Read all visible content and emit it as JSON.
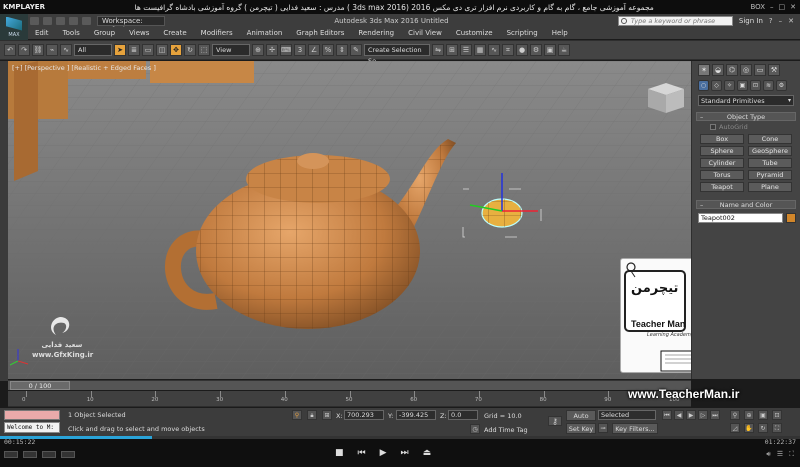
{
  "player": {
    "logo": "KMPLAYER",
    "title": "مجموعه آموزشی جامع ، گام به گام و کاربردی نرم افزار تری دی مکس 2016 (3ds max 2016 ) مدرس : سعید فدایی ( تیچرمن ) گروه آموزشی بادشاه گرافیست ها",
    "window_label": "BOX",
    "time_elapsed": "00:15:22",
    "time_total": "01:22:37",
    "progress": 0.19
  },
  "app": {
    "logo_label": "MAX",
    "workspace": "Workspace: Default",
    "title": "Autodesk 3ds Max 2016    Untitled",
    "search_placeholder": "Type a keyword or phrase",
    "sign_in": "Sign In"
  },
  "menu": [
    "Edit",
    "Tools",
    "Group",
    "Views",
    "Create",
    "Modifiers",
    "Animation",
    "Graph Editors",
    "Rendering",
    "Civil View",
    "Customize",
    "Scripting",
    "Help"
  ],
  "toolbar": {
    "filter": "All",
    "ref_coord": "View",
    "named_sel": "Create Selection Se"
  },
  "viewport": {
    "label": "[+] [Perspective ] [Realistic + Edged Faces ]",
    "object_color": "#d1862a"
  },
  "command_panel": {
    "category_dropdown": "Standard Primitives",
    "object_type_header": "Object Type",
    "autogrid": "AutoGrid",
    "buttons": [
      "Box",
      "Cone",
      "Sphere",
      "GeoSphere",
      "Cylinder",
      "Tube",
      "Torus",
      "Pyramid",
      "Teapot",
      "Plane"
    ],
    "name_color_header": "Name and Color",
    "object_name": "Teapot002",
    "swatch_color": "#d1862a"
  },
  "watermark": {
    "site": "www.TeacherMan.ir",
    "teacher_name": "Teacher Man",
    "teacher_fa": "تیچرمن",
    "tagline": "Learning Academy",
    "gfx_name_fa": "سعید فدایی",
    "gfx_site": "www.GfxKing.ir"
  },
  "timeline": {
    "frame": "0 / 100",
    "ticks": [
      0,
      10,
      20,
      30,
      40,
      50,
      60,
      70,
      80,
      90,
      100
    ]
  },
  "status": {
    "welcome": "Welcome to M:",
    "selected": "1 Object Selected",
    "prompt": "Click and drag to select and move objects",
    "x_label": "X:",
    "x_value": "700.293",
    "y_label": "Y:",
    "y_value": "-399.425",
    "z_label": "Z:",
    "z_value": "0.0",
    "grid": "Grid = 10.0",
    "add_time_tag": "Add Time Tag",
    "auto_key": "Auto Key",
    "set_key": "Set Key",
    "key_mode": "Selected",
    "key_filters": "Key Filters..."
  }
}
